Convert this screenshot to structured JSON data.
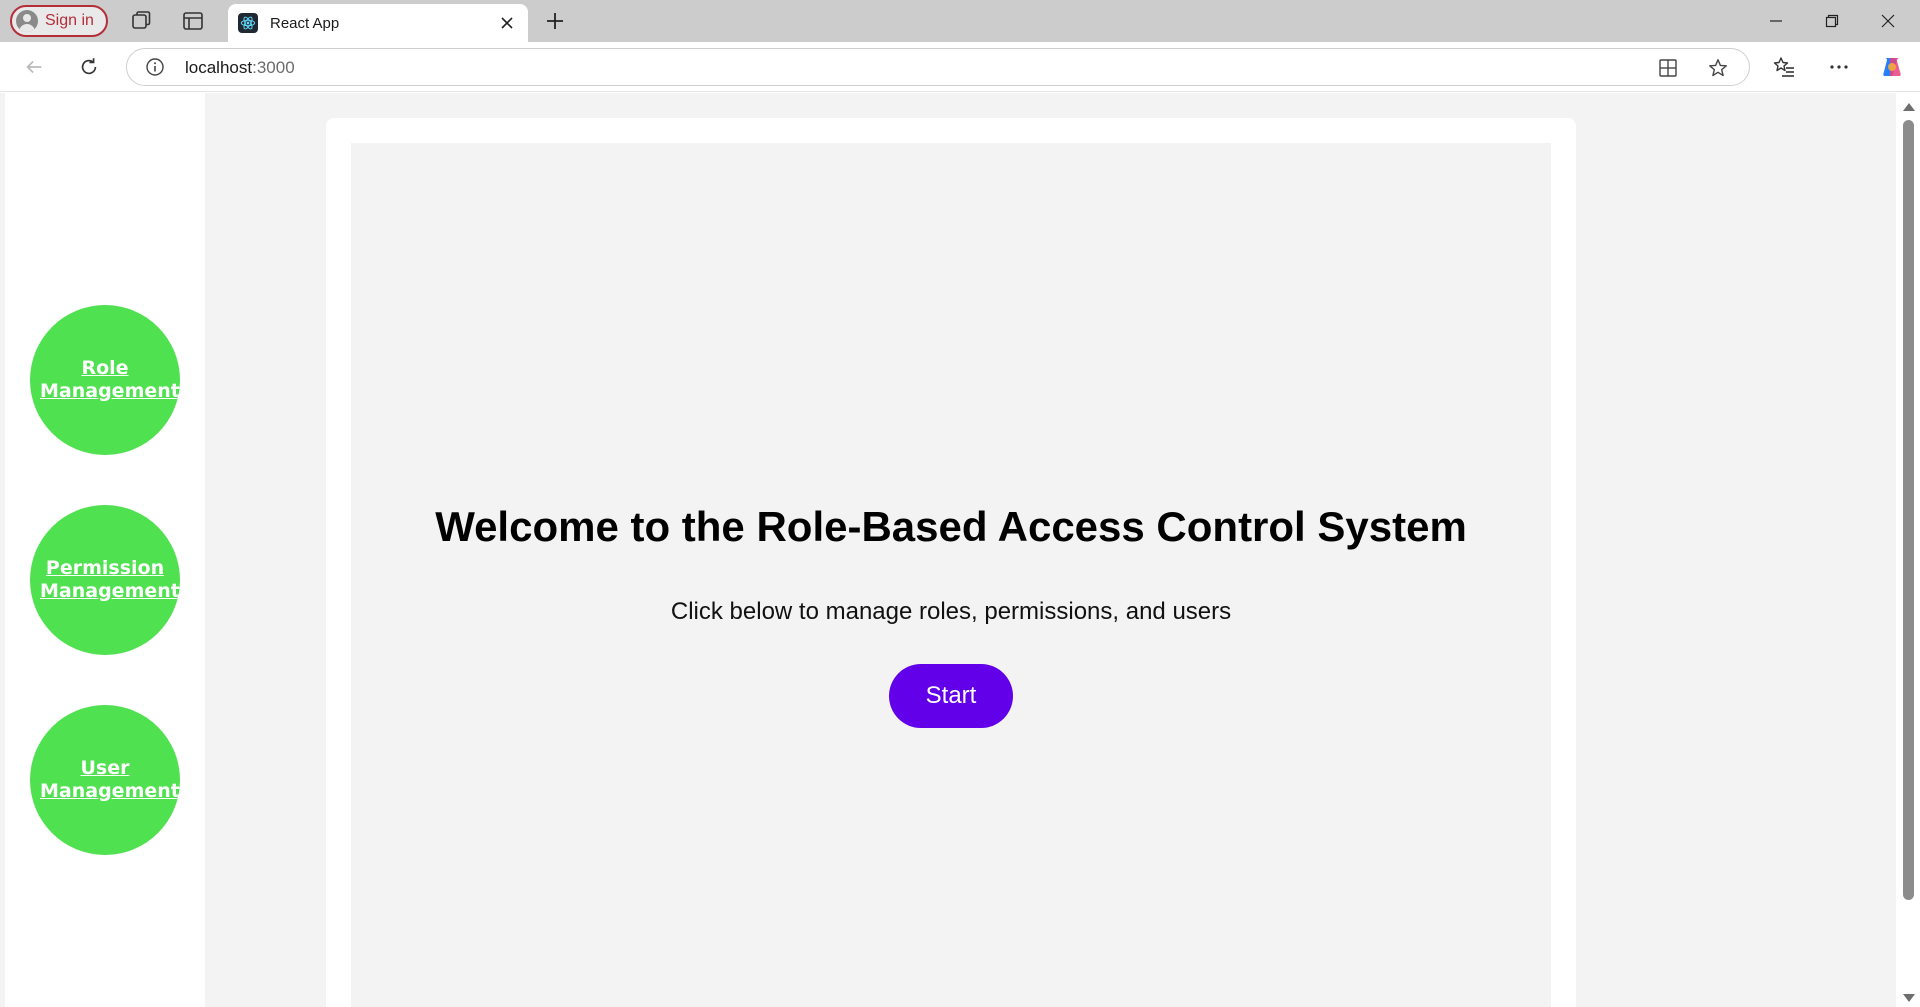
{
  "browser": {
    "signin_label": "Sign in",
    "tab_title": "React App",
    "url_host": "localhost",
    "url_port": ":3000"
  },
  "sidebar": {
    "items": [
      {
        "line1": "Role",
        "line2": "Management"
      },
      {
        "line1": "Permission",
        "line2": "Management"
      },
      {
        "line1": "User",
        "line2": "Management"
      }
    ]
  },
  "main": {
    "heading": "Welcome to the Role-Based Access Control System",
    "subtitle": "Click below to manage roles, permissions, and users",
    "start_label": "Start"
  },
  "colors": {
    "nav_circle": "#4fe14f",
    "start_button": "#6200ea",
    "signin_accent": "#b42e3a"
  }
}
